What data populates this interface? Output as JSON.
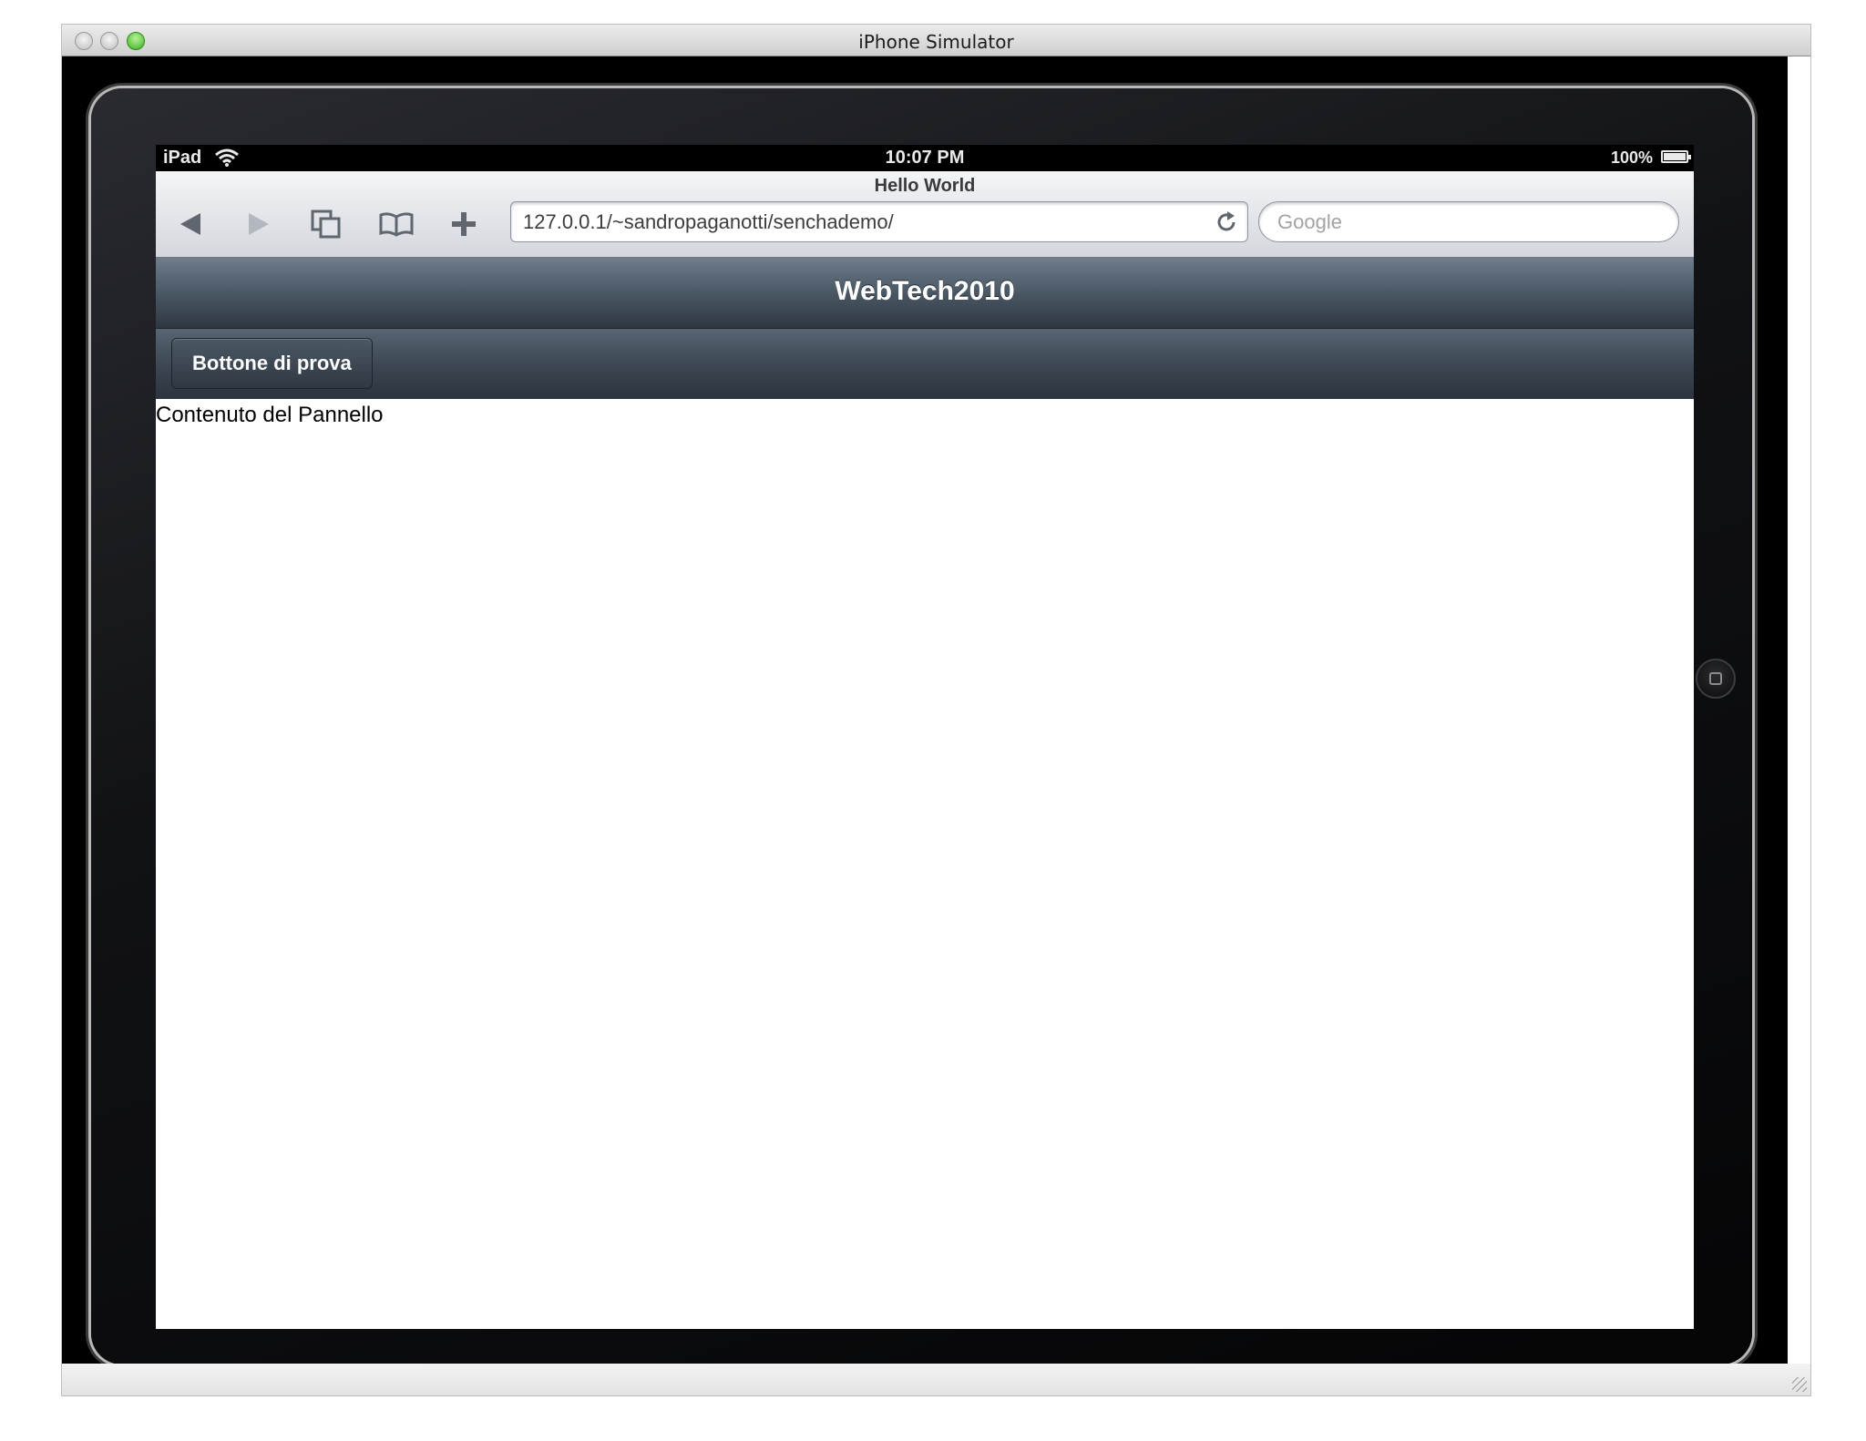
{
  "window": {
    "title": "iPhone Simulator"
  },
  "statusbar": {
    "device": "iPad",
    "time": "10:07 PM",
    "battery": "100%"
  },
  "safari": {
    "page_title": "Hello World",
    "url": "127.0.0.1/~sandropaganotti/senchademo/",
    "search_placeholder": "Google"
  },
  "app": {
    "title": "WebTech2010",
    "button_label": "Bottone di prova",
    "panel_content": "Contenuto del Pannello"
  },
  "icons": {
    "back": "back-arrow-icon",
    "forward": "forward-arrow-icon",
    "pages": "pages-icon",
    "bookmarks": "bookmarks-icon",
    "add": "add-icon",
    "reload": "reload-icon",
    "wifi": "wifi-icon",
    "battery": "battery-icon"
  },
  "colors": {
    "toolbar_top": "#6f7d8c",
    "toolbar_bottom": "#2e3843",
    "zoom_button": "#3fae23"
  }
}
